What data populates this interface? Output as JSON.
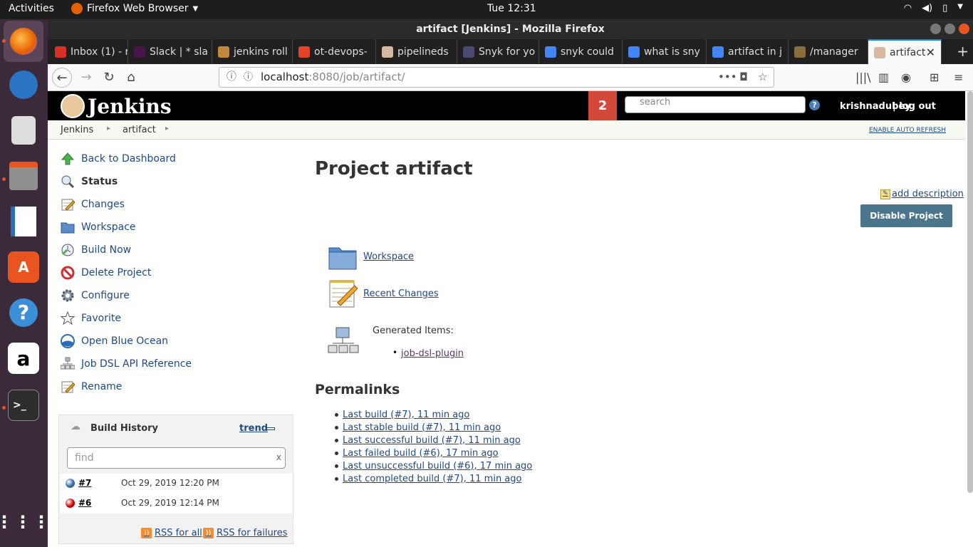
{
  "system": {
    "activities": "Activities",
    "app_name": "Firefox Web Browser",
    "clock": "Tue 12:31"
  },
  "window": {
    "title": "artifact [Jenkins] - Mozilla Firefox"
  },
  "tabs": [
    {
      "label": "Inbox (1) - r",
      "color": "#d93025"
    },
    {
      "label": "Slack | * sla",
      "color": "#4a154b"
    },
    {
      "label": "jenkins roll",
      "color": "#c1883b"
    },
    {
      "label": "ot-devops-",
      "color": "#e24329"
    },
    {
      "label": "pipelineds",
      "color": "#d9b8a0"
    },
    {
      "label": "Snyk for yo",
      "color": "#4c4a73"
    },
    {
      "label": "snyk could",
      "color": "#4285f4"
    },
    {
      "label": "what is sny",
      "color": "#4285f4"
    },
    {
      "label": "artifact in j",
      "color": "#4285f4"
    },
    {
      "label": "/manager",
      "color": "#8a6d3b"
    },
    {
      "label": "artifact",
      "color": "#d9b8a0",
      "active": true
    }
  ],
  "url": {
    "host": "localhost",
    "rest": ":8080/job/artifact/"
  },
  "jenkins": {
    "logo_text": "Jenkins",
    "notification_count": "2",
    "search_placeholder": "search",
    "help": "?",
    "user": "krishnadubey",
    "logout": "| log out",
    "breadcrumbs": [
      "Jenkins",
      "artifact"
    ],
    "auto_refresh": "ENABLE AUTO REFRESH"
  },
  "side_tasks": [
    {
      "label": "Back to Dashboard",
      "icon": "up-arrow-icon"
    },
    {
      "label": "Status",
      "icon": "search-icon",
      "bold": true
    },
    {
      "label": "Changes",
      "icon": "notepad-icon"
    },
    {
      "label": "Workspace",
      "icon": "folder-icon"
    },
    {
      "label": "Build Now",
      "icon": "clock-icon"
    },
    {
      "label": "Delete Project",
      "icon": "no-entry-icon"
    },
    {
      "label": "Configure",
      "icon": "gear-icon"
    },
    {
      "label": "Favorite",
      "icon": "star-icon"
    },
    {
      "label": "Open Blue Ocean",
      "icon": "blue-ocean-icon"
    },
    {
      "label": "Job DSL API Reference",
      "icon": "network-icon"
    },
    {
      "label": "Rename",
      "icon": "notepad-icon"
    }
  ],
  "build_history": {
    "title": "Build History",
    "trend": "trend",
    "find_placeholder": "find",
    "clear": "x",
    "builds": [
      {
        "number": "#7",
        "date": "Oct 29, 2019 12:20 PM",
        "status_color": "#3465a4"
      },
      {
        "number": "#6",
        "date": "Oct 29, 2019 12:14 PM",
        "status_color": "#cc0000"
      }
    ],
    "rss_all": "RSS for all",
    "rss_failures": "RSS for failures"
  },
  "main": {
    "title": "Project artifact",
    "add_description": "add description",
    "disable_button": "Disable Project",
    "workspace_link": "Workspace",
    "recent_changes_link": "Recent Changes",
    "generated_label": "Generated Items:",
    "generated_item": "job-dsl-plugin",
    "permalinks_title": "Permalinks",
    "permalinks": [
      "Last build (#7), 11 min ago",
      "Last stable build (#7), 11 min ago",
      "Last successful build (#7), 11 min ago",
      "Last failed build (#6), 17 min ago",
      "Last unsuccessful build (#6), 17 min ago",
      "Last completed build (#7), 11 min ago"
    ]
  }
}
